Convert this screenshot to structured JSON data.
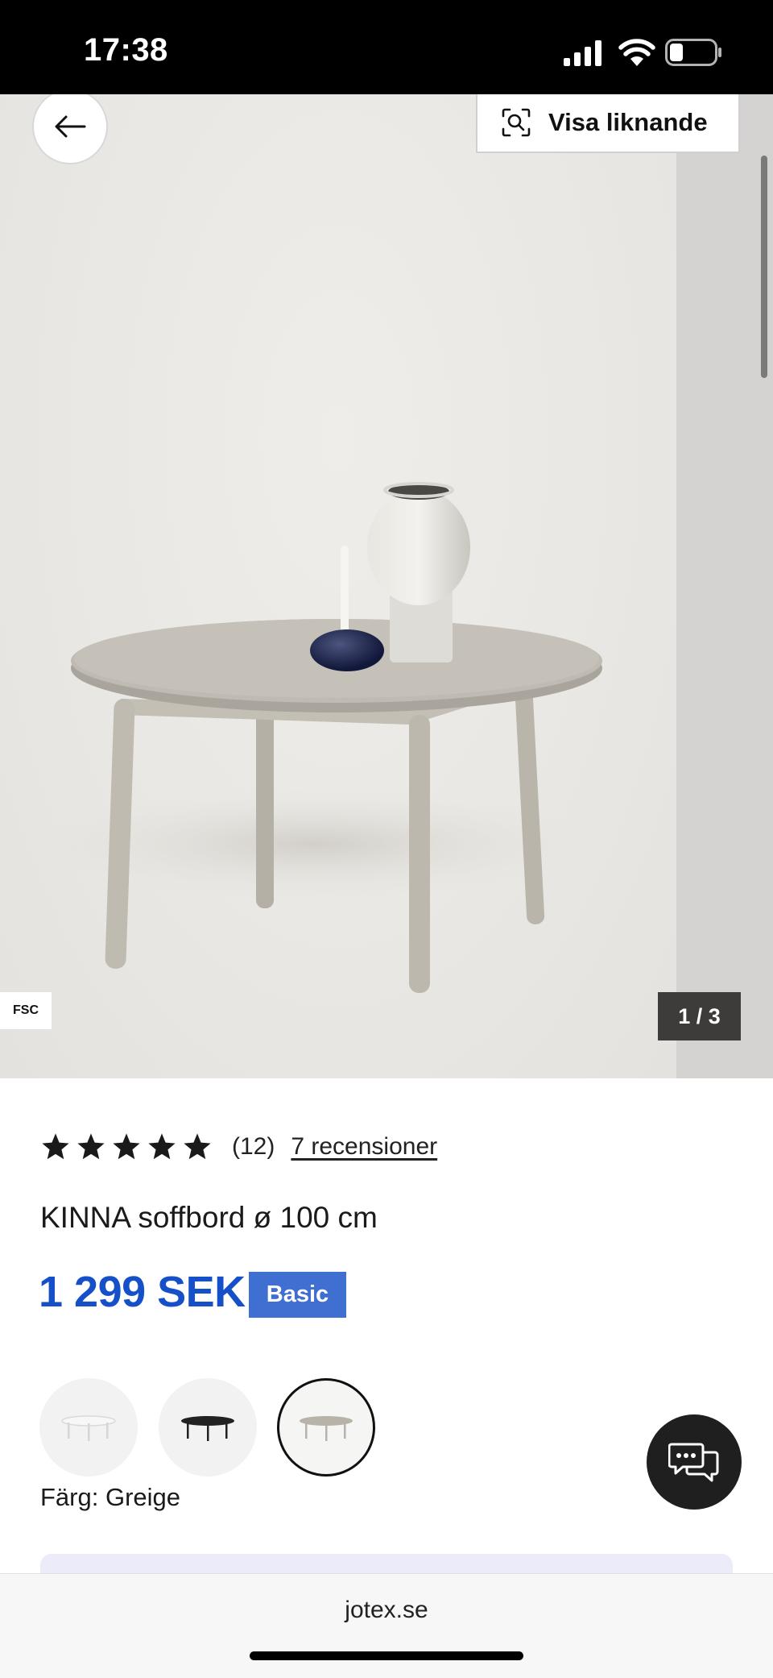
{
  "status_bar": {
    "time": "17:38"
  },
  "gallery": {
    "similar_button_label": "Visa liknande",
    "fsc_label": "FSC",
    "page_counter": "1 / 3"
  },
  "product": {
    "rating": {
      "stars": 5,
      "count_label": "(12)",
      "reviews_link": "7 recensioner"
    },
    "title": "KINNA soffbord ø 100 cm",
    "price": "1 299 SEK",
    "price_badge": "Basic",
    "colors": [
      {
        "name": "white-table-swatch",
        "color": "#f0f0f0"
      },
      {
        "name": "black-table-swatch",
        "color": "#1e1e1e"
      },
      {
        "name": "greige-table-swatch",
        "color": "#b6b1a7"
      }
    ],
    "color_label": "Färg: Greige"
  },
  "browser": {
    "url": "jotex.se"
  },
  "theme": {
    "price_color": "#1650c9",
    "badge_color": "#3f6fd0",
    "accent_light": "#ecebfa"
  }
}
